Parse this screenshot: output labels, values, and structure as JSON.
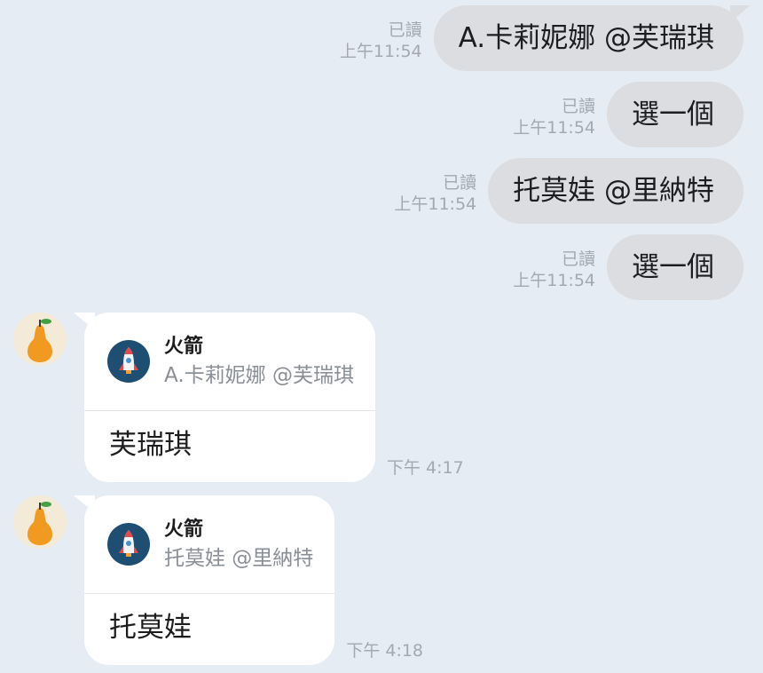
{
  "outgoing": [
    {
      "read": "已讀",
      "time": "上午11:54",
      "text": "A.卡莉妮娜 @芙瑞琪"
    },
    {
      "read": "已讀",
      "time": "上午11:54",
      "text": "選一個"
    },
    {
      "read": "已讀",
      "time": "上午11:54",
      "text": "托莫娃 @里納特"
    },
    {
      "read": "已讀",
      "time": "上午11:54",
      "text": "選一個"
    }
  ],
  "incoming": [
    {
      "reply_name": "火箭",
      "reply_quote": "A.卡莉妮娜 @芙瑞琪",
      "text": "芙瑞琪",
      "time": "下午 4:17"
    },
    {
      "reply_name": "火箭",
      "reply_quote": "托莫娃 @里納特",
      "text": "托莫娃",
      "time": "下午 4:18"
    }
  ],
  "icons": {
    "sender_avatar": "pear-icon",
    "reply_avatar": "rocket-icon"
  },
  "colors": {
    "background": "#e6ecf3",
    "outgoing_bubble": "#dbdde0",
    "incoming_bubble": "#ffffff",
    "meta_text": "#a3a9b1"
  }
}
